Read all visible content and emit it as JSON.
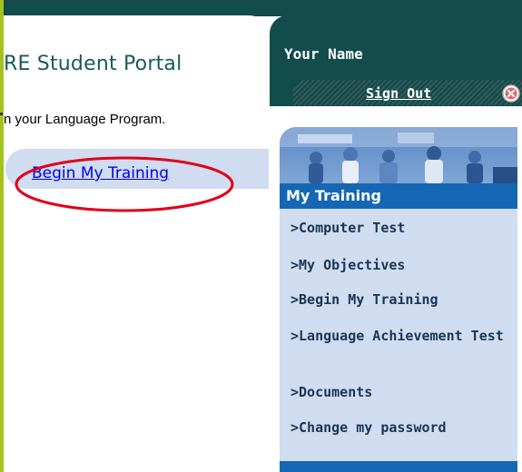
{
  "header": {
    "portal_title": "RE Student Portal",
    "intro_text": "n your Language Program."
  },
  "main": {
    "begin_link": "Begin My Training"
  },
  "user": {
    "name": "Your Name",
    "sign_out": "Sign Out"
  },
  "sidebar": {
    "section_title": "My Training",
    "items": [
      {
        "label": ">Computer Test"
      },
      {
        "label": ">My Objectives"
      },
      {
        "label": ">Begin My Training"
      },
      {
        "label": ">Language Achievement Test"
      },
      {
        "label": ">Documents"
      },
      {
        "label": ">Change my password"
      }
    ]
  },
  "colors": {
    "header_teal": "#134c4c",
    "panel_blue": "#d0dcef",
    "section_blue": "#1667b3",
    "accent_green": "#a3c41f",
    "highlight_red": "#e0001a"
  },
  "icons": {
    "close": "close-icon",
    "highlight": "red-ellipse-annotation"
  }
}
